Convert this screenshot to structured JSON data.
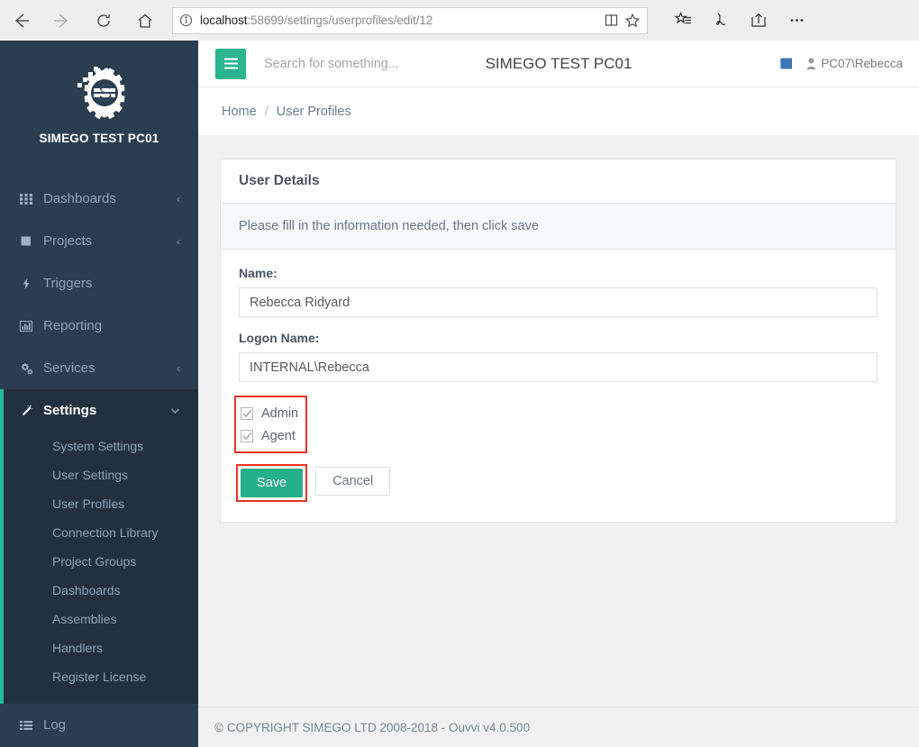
{
  "browser": {
    "back_icon": "arrow-left-icon",
    "forward_icon": "arrow-right-icon",
    "refresh_icon": "refresh-icon",
    "home_icon": "home-icon",
    "info_icon": "info-icon",
    "url_host": "localhost",
    "url_path": ":58699/settings/userprofiles/edit/12",
    "reading_view_icon": "reading-view-icon",
    "favorite_icon": "star-icon",
    "hub_icon": "favorites-list-icon",
    "web_note_icon": "web-note-pen-icon",
    "share_icon": "share-icon",
    "more_icon": "more-ellipsis-icon"
  },
  "sidebar": {
    "logo_icon": "simego-gear-logo",
    "brand_name": "SIMEGO TEST PC01",
    "items": [
      {
        "label": "Dashboards",
        "icon": "grid-icon",
        "caret": "‹"
      },
      {
        "label": "Projects",
        "icon": "book-icon",
        "caret": "‹"
      },
      {
        "label": "Triggers",
        "icon": "bolt-icon",
        "caret": ""
      },
      {
        "label": "Reporting",
        "icon": "bar-chart-icon",
        "caret": ""
      },
      {
        "label": "Services",
        "icon": "gears-icon",
        "caret": "‹"
      }
    ],
    "settings": {
      "label": "Settings",
      "icon": "magic-wand-icon",
      "caret": "⌄",
      "accent_color": "#25b99a",
      "sub_items": [
        "System Settings",
        "User Settings",
        "User Profiles",
        "Connection Library",
        "Project Groups",
        "Dashboards",
        "Assemblies",
        "Handlers",
        "Register License"
      ]
    },
    "log": {
      "label": "Log",
      "icon": "list-icon"
    }
  },
  "topbar": {
    "menu_icon": "hamburger-menu-icon",
    "search_placeholder": "Search for something...",
    "search_value": "",
    "title": "SIMEGO TEST PC01",
    "docs_icon": "book-blue-icon",
    "user_icon": "person-icon",
    "user_name": "PC07\\Rebecca"
  },
  "breadcrumb": {
    "home": "Home",
    "separator": "/",
    "current": "User Profiles"
  },
  "card": {
    "title": "User Details",
    "info": "Please fill in the information needed, then click save",
    "fields": [
      {
        "label": "Name:",
        "value": "Rebecca Ridyard"
      },
      {
        "label": "Logon Name:",
        "value": "INTERNAL\\Rebecca"
      }
    ],
    "checkboxes": [
      {
        "label": "Admin",
        "checked": true
      },
      {
        "label": "Agent",
        "checked": true
      }
    ],
    "save_label": "Save",
    "cancel_label": "Cancel",
    "save_color": "#26b088",
    "highlight_color": "#ee3224"
  },
  "footer": {
    "text": "© COPYRIGHT SIMEGO LTD 2008-2018 - Ouvvi v4.0.500"
  }
}
